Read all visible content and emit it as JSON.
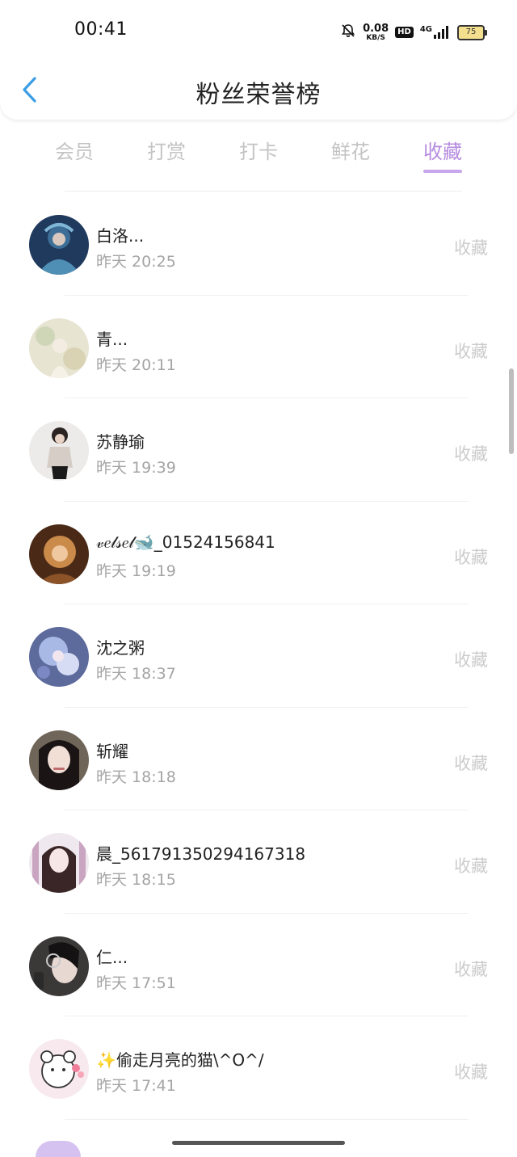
{
  "status_bar": {
    "time": "00:41",
    "net_speed": "0.08",
    "net_unit": "KB/S",
    "hd": "HD",
    "signal": "4G",
    "battery": "75"
  },
  "header": {
    "title": "粉丝荣誉榜",
    "back_icon": "chevron-left-icon"
  },
  "tabs": [
    {
      "label": "会员",
      "active": false
    },
    {
      "label": "打赏",
      "active": false
    },
    {
      "label": "打卡",
      "active": false
    },
    {
      "label": "鲜花",
      "active": false
    },
    {
      "label": "收藏",
      "active": true
    }
  ],
  "colors": {
    "accent": "#b58be0",
    "back_arrow": "#3a9ee6",
    "muted_text": "#a4a4a4",
    "action_text": "#cccccc"
  },
  "fans": [
    {
      "name": "白洛...",
      "time": "昨天 20:25",
      "action": "收藏"
    },
    {
      "name": "青...",
      "time": "昨天 20:11",
      "action": "收藏"
    },
    {
      "name": "苏静瑜",
      "time": "昨天 19:39",
      "action": "收藏"
    },
    {
      "name": "𝓋𝑒𝓁𝓈𝑒𝓁🐋_01524156841",
      "time": "昨天 19:19",
      "action": "收藏"
    },
    {
      "name": "沈之粥",
      "time": "昨天 18:37",
      "action": "收藏"
    },
    {
      "name": "斩耀",
      "time": "昨天 18:18",
      "action": "收藏"
    },
    {
      "name": "晨_561791350294167318",
      "time": "昨天 18:15",
      "action": "收藏"
    },
    {
      "name": "仁...",
      "time": "昨天 17:51",
      "action": "收藏"
    },
    {
      "name": "✨偷走月亮的猫\\^O^/",
      "time": "昨天 17:41",
      "action": "收藏"
    }
  ]
}
